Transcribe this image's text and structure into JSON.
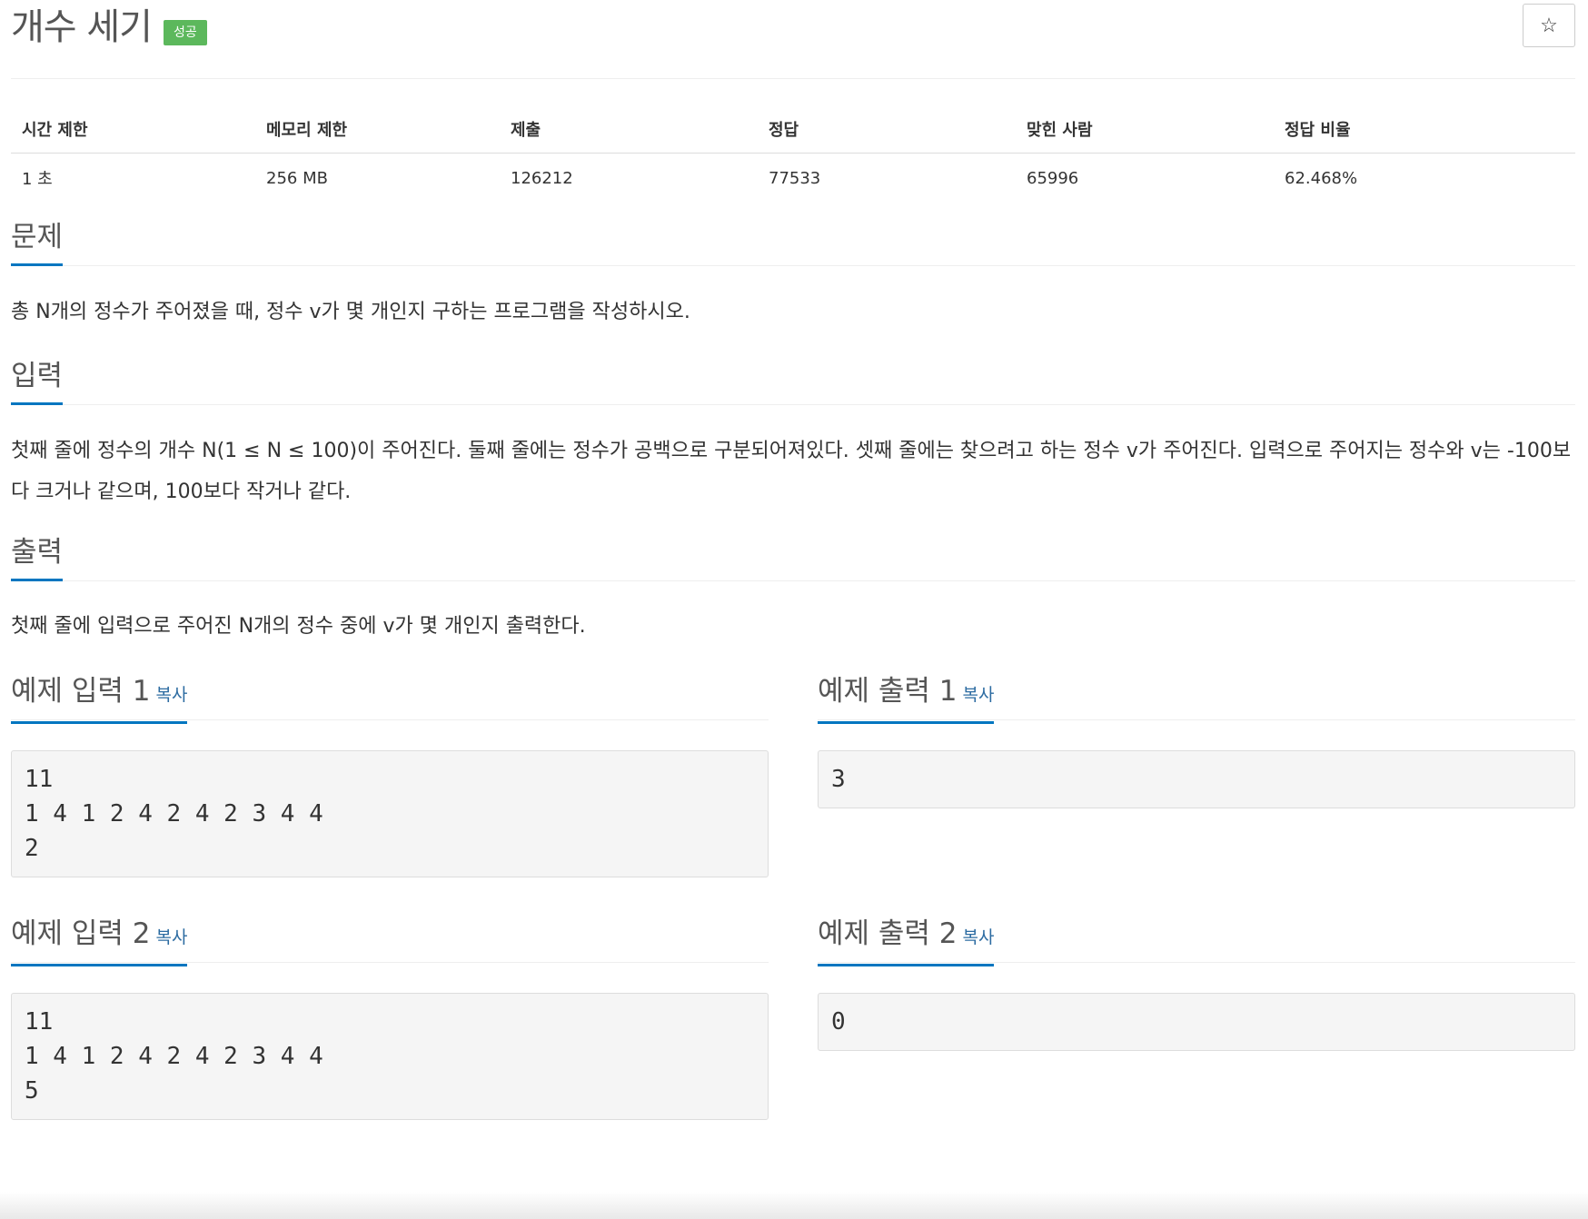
{
  "problem": {
    "title": "개수 세기",
    "status_badge": "성공",
    "star_icon": "☆"
  },
  "stats": {
    "headers": [
      "시간 제한",
      "메모리 제한",
      "제출",
      "정답",
      "맞힌 사람",
      "정답 비율"
    ],
    "values": [
      "1 초",
      "256 MB",
      "126212",
      "77533",
      "65996",
      "62.468%"
    ]
  },
  "sections": {
    "description": {
      "heading": "문제",
      "text": "총 N개의 정수가 주어졌을 때, 정수 v가 몇 개인지 구하는 프로그램을 작성하시오."
    },
    "input": {
      "heading": "입력",
      "text": "첫째 줄에 정수의 개수 N(1 ≤ N ≤ 100)이 주어진다. 둘째 줄에는 정수가 공백으로 구분되어져있다. 셋째 줄에는 찾으려고 하는 정수 v가 주어진다. 입력으로 주어지는 정수와 v는 -100보다 크거나 같으며, 100보다 작거나 같다."
    },
    "output": {
      "heading": "출력",
      "text": "첫째 줄에 입력으로 주어진 N개의 정수 중에 v가 몇 개인지 출력한다."
    }
  },
  "samples": {
    "copy_label": "복사",
    "input1": {
      "heading": "예제 입력 1",
      "content": "11\n1 4 1 2 4 2 4 2 3 4 4\n2"
    },
    "output1": {
      "heading": "예제 출력 1",
      "content": "3"
    },
    "input2": {
      "heading": "예제 입력 2",
      "content": "11\n1 4 1 2 4 2 4 2 3 4 4\n5"
    },
    "output2": {
      "heading": "예제 출력 2",
      "content": "0"
    }
  }
}
